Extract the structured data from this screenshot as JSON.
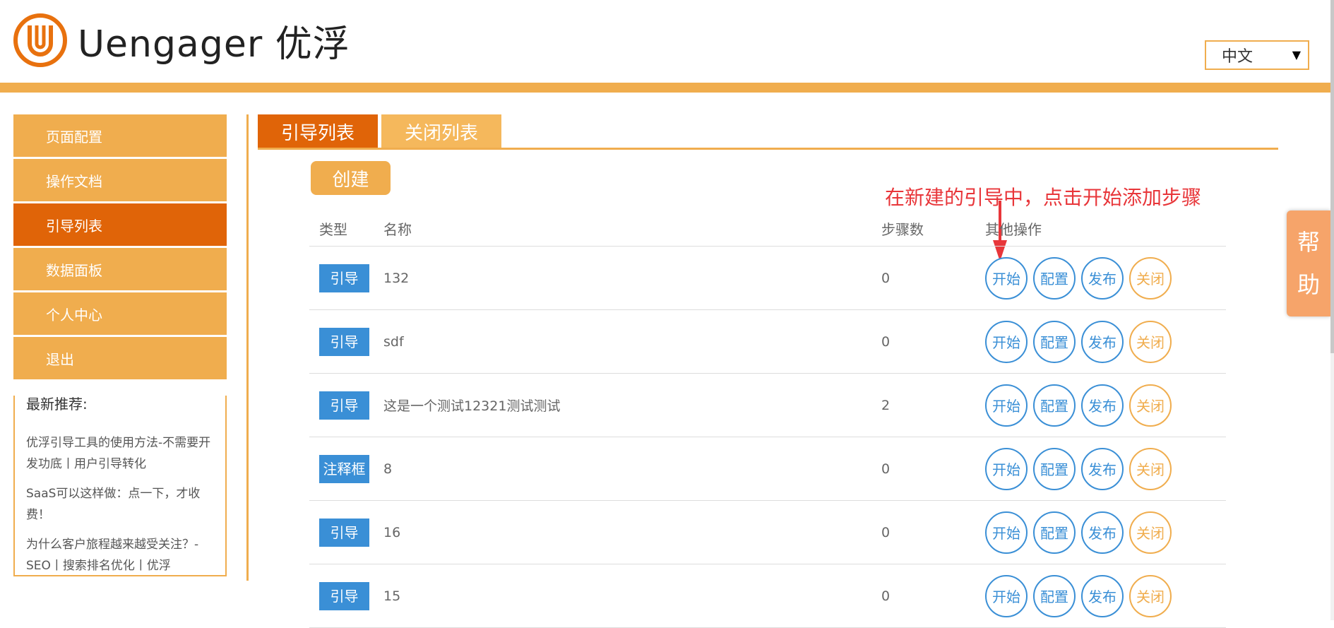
{
  "header": {
    "logo_text": "Uengager 优浮",
    "language": "中文"
  },
  "sidebar": {
    "items": [
      {
        "label": "页面配置"
      },
      {
        "label": "操作文档"
      },
      {
        "label": "引导列表"
      },
      {
        "label": "数据面板"
      },
      {
        "label": "个人中心"
      },
      {
        "label": "退出"
      }
    ],
    "active_index": 2
  },
  "recommend": {
    "title": "最新推荐:",
    "links": [
      "优浮引导工具的使用方法-不需要开发功底丨用户引导转化",
      "SaaS可以这样做：点一下，才收费！",
      "为什么客户旅程越来越受关注？-SEO丨搜索排名优化丨优浮"
    ]
  },
  "tabs": [
    {
      "label": "引导列表"
    },
    {
      "label": "关闭列表"
    }
  ],
  "create_label": "创建",
  "annotation": "在新建的引导中，点击开始添加步骤",
  "table": {
    "headers": {
      "type": "类型",
      "name": "名称",
      "steps": "步骤数",
      "ops": "其他操作"
    },
    "ops": {
      "start": "开始",
      "config": "配置",
      "publish": "发布",
      "close": "关闭"
    },
    "rows": [
      {
        "type": "引导",
        "name": "132",
        "steps": "0"
      },
      {
        "type": "引导",
        "name": "sdf",
        "steps": "0"
      },
      {
        "type": "引导",
        "name": "这是一个测试12321测试测试",
        "steps": "2"
      },
      {
        "type": "注释框",
        "name": "8",
        "steps": "0"
      },
      {
        "type": "引导",
        "name": "16",
        "steps": "0"
      },
      {
        "type": "引导",
        "name": "15",
        "steps": "0"
      }
    ]
  },
  "help": {
    "line1": "帮",
    "line2": "助"
  },
  "colors": {
    "accent": "#f0ad4e",
    "active": "#e06408",
    "blue": "#3a8fd6",
    "annotation": "#e8363a"
  }
}
